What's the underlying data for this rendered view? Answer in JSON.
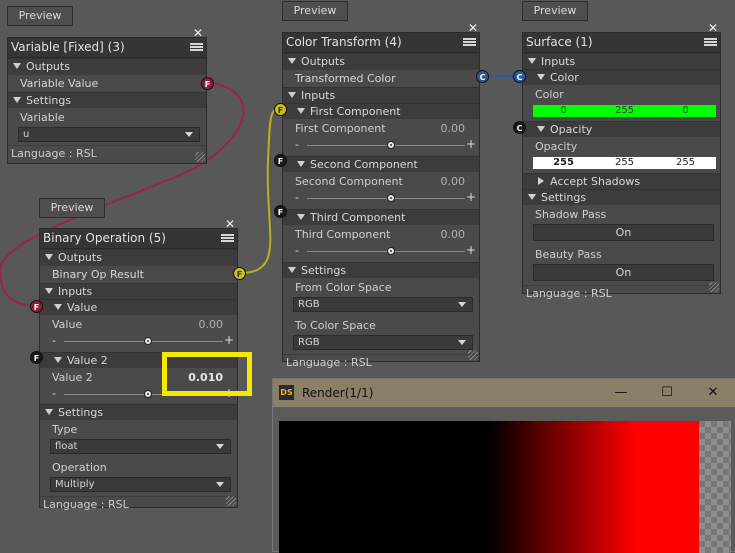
{
  "preview_label": "Preview",
  "close_glyph": "✕",
  "language_label": "Language : RSL",
  "variable_node": {
    "title": "Variable [Fixed] (3)",
    "outputs_label": "Outputs",
    "variable_value_label": "Variable Value",
    "settings_label": "Settings",
    "variable_label": "Variable",
    "variable_value": "u"
  },
  "binary_node": {
    "title": "Binary Operation (5)",
    "outputs_label": "Outputs",
    "result_label": "Binary Op Result",
    "inputs_label": "Inputs",
    "value_section": "Value",
    "value_label": "Value",
    "value_number": "0.00",
    "value2_section": "Value 2",
    "value2_label": "Value 2",
    "value2_number": "0.010",
    "settings_label": "Settings",
    "type_label": "Type",
    "type_value": "float",
    "operation_label": "Operation",
    "operation_value": "Multiply"
  },
  "color_node": {
    "title": "Color Transform (4)",
    "outputs_label": "Outputs",
    "transformed_label": "Transformed Color",
    "inputs_label": "Inputs",
    "first_section": "First Component",
    "first_label": "First Component",
    "first_value": "0.00",
    "second_section": "Second Component",
    "second_label": "Second Component",
    "second_value": "0.00",
    "third_section": "Third Component",
    "third_label": "Third Component",
    "third_value": "0.00",
    "settings_label": "Settings",
    "from_label": "From Color Space",
    "from_value": "RGB",
    "to_label": "To Color Space",
    "to_value": "RGB"
  },
  "surface_node": {
    "title": "Surface (1)",
    "inputs_label": "Inputs",
    "color_section": "Color",
    "color_label": "Color",
    "color_r": "0",
    "color_g": "255",
    "color_b": "0",
    "opacity_section": "Opacity",
    "opacity_label": "Opacity",
    "opacity_r": "255",
    "opacity_g": "255",
    "opacity_b": "255",
    "accept_shadows_label": "Accept Shadows",
    "settings_label": "Settings",
    "shadow_pass_label": "Shadow Pass",
    "shadow_pass_value": "On",
    "beauty_pass_label": "Beauty Pass",
    "beauty_pass_value": "On"
  },
  "ports": {
    "f": "F",
    "c": "C"
  },
  "render_window": {
    "title": "Render(1/1)",
    "app_icon_label": "DS",
    "minimize_glyph": "—",
    "maximize_glyph": "☐",
    "close_glyph": "✕"
  },
  "colors": {
    "surface_color_bar": "#00ff00",
    "render_red": "#ff0000",
    "wire_red": "#9b2448",
    "wire_yellow": "#b8b020",
    "wire_blue": "#2a5aa0",
    "highlight": "#f2ea00"
  }
}
